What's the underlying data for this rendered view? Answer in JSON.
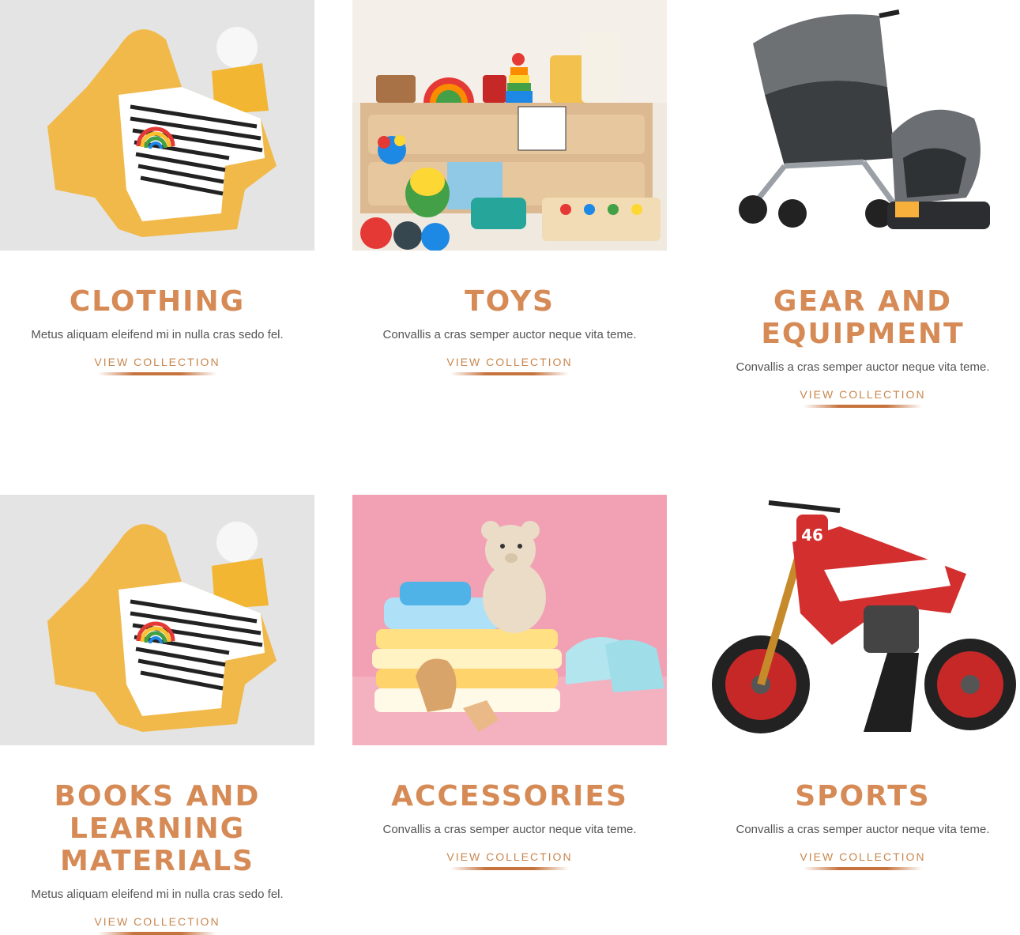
{
  "colors": {
    "accent": "#d68a55",
    "text": "#555555",
    "underline": "#c6733e"
  },
  "cards": [
    {
      "title": "CLOTHING",
      "description": "Metus aliquam eleifend mi in nulla cras sedo fel.",
      "cta": "VIEW COLLECTION",
      "image": "yellow-raincoat-rainbow-shirt-photo"
    },
    {
      "title": "TOYS",
      "description": "Convallis a cras semper auctor neque vita teme.",
      "cta": "VIEW COLLECTION",
      "image": "wooden-toys-shelf-photo"
    },
    {
      "title": "GEAR AND EQUIPMENT",
      "description": "Convallis a cras semper auctor neque vita teme.",
      "cta": "VIEW COLLECTION",
      "image": "stroller-car-seat-photo"
    },
    {
      "title": "BOOKS AND LEARNING MATERIALS",
      "description": "Metus aliquam eleifend mi in nulla cras sedo fel.",
      "cta": "VIEW COLLECTION",
      "image": "yellow-raincoat-rainbow-shirt-photo"
    },
    {
      "title": "ACCESSORIES",
      "description": "Convallis a cras semper auctor neque vita teme.",
      "cta": "VIEW COLLECTION",
      "image": "teddy-bear-baby-clothes-photo"
    },
    {
      "title": "SPORTS",
      "description": "Convallis a cras semper auctor neque vita teme.",
      "cta": "VIEW COLLECTION",
      "image": "red-dirt-bike-toy-photo"
    }
  ]
}
